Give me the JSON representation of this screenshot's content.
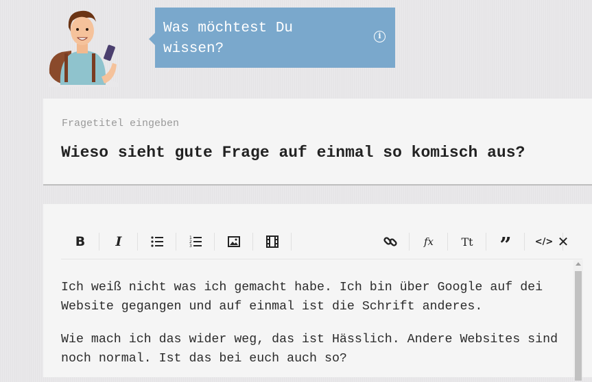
{
  "header": {
    "bubble_text": "Was möchtest Du wissen?",
    "info_icon": "info-circle-icon",
    "bubble_color": "#7aa8cc"
  },
  "title_field": {
    "label": "Fragetitel eingeben",
    "value": "Wieso sieht gute Frage auf einmal so komisch aus?"
  },
  "toolbar": {
    "buttons": [
      {
        "name": "bold-icon",
        "glyph": "B"
      },
      {
        "name": "italic-icon",
        "glyph": "I"
      },
      {
        "name": "bullet-list-icon"
      },
      {
        "name": "numbered-list-icon"
      },
      {
        "name": "image-icon"
      },
      {
        "name": "video-icon"
      },
      {
        "name": "link-icon"
      },
      {
        "name": "formula-icon",
        "glyph": "fx"
      },
      {
        "name": "text-size-icon",
        "glyph": "Tt"
      },
      {
        "name": "quote-icon",
        "glyph": "”"
      },
      {
        "name": "code-icon",
        "glyph": "</>"
      },
      {
        "name": "close-icon",
        "glyph": "✕"
      }
    ]
  },
  "editor": {
    "paragraphs": [
      "Ich weiß nicht was ich gemacht habe. Ich bin über Google auf dei Website gegangen und auf einmal ist die Schrift anderes.",
      "Wie mach ich das wider weg, das ist Hässlich. Andere Websites sind noch normal. Ist das bei euch auch so?"
    ]
  }
}
